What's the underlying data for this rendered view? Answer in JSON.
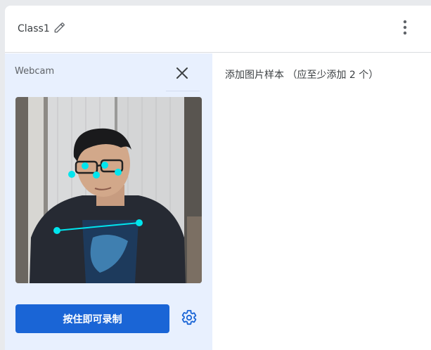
{
  "class_card": {
    "name": "Class1",
    "icons": {
      "edit": "pencil-icon",
      "more": "more-vert-icon"
    }
  },
  "webcam_panel": {
    "label": "Webcam",
    "close_icon": "close-icon",
    "record_button_label": "按住即可录制",
    "settings_icon": "gear-icon"
  },
  "samples": {
    "label": "添加图片样本 （应至少添加 2 个）"
  },
  "colors": {
    "accent": "#1a65d6",
    "panel_bg": "#e8f0fe",
    "pose_keypoints": "#00e5ee"
  }
}
